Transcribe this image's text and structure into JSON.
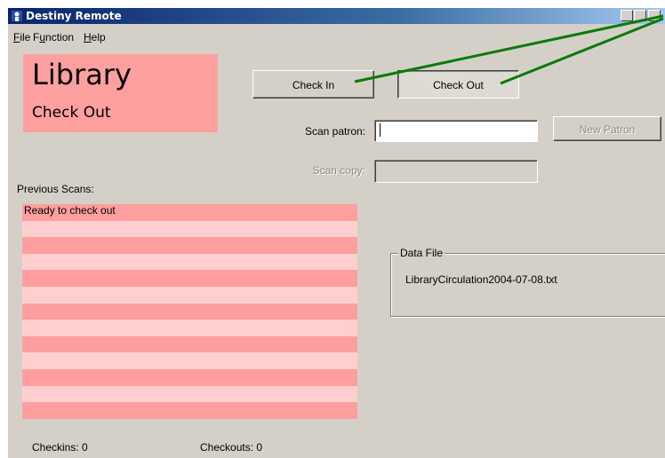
{
  "window": {
    "title": "Destiny Remote",
    "controls": {
      "minimize": "_",
      "maximize": "□",
      "close": "×"
    }
  },
  "menu": {
    "items": [
      {
        "label": "File",
        "mnemonic": "F",
        "rest": "ile"
      },
      {
        "label": "Function",
        "mnemonic": "u",
        "prefix": "F",
        "rest": "nction"
      },
      {
        "label": "Help",
        "mnemonic": "H",
        "rest": "elp"
      }
    ]
  },
  "status_panel": {
    "title": "Library",
    "mode": "Check Out",
    "color": "#ffa0a0"
  },
  "actions": {
    "check_in": "Check In",
    "check_out": "Check Out",
    "new_patron": "New Patron"
  },
  "fields": {
    "scan_patron_label": "Scan patron:",
    "scan_patron_value": "",
    "scan_copy_label": "Scan copy:",
    "scan_copy_value": ""
  },
  "previous_scans": {
    "label": "Previous Scans:",
    "rows": [
      "Ready to check out",
      "",
      "",
      "",
      "",
      "",
      "",
      "",
      "",
      "",
      "",
      "",
      ""
    ]
  },
  "data_file": {
    "legend": "Data File",
    "filename": "LibraryCirculation2004-07-08.txt"
  },
  "counters": {
    "checkins": "Checkins: 0",
    "checkouts": "Checkouts: 0"
  },
  "colors": {
    "annotation_arrow": "#0a7a0a",
    "row_dark": "#ff9e9e",
    "row_light": "#ffcfcf"
  }
}
